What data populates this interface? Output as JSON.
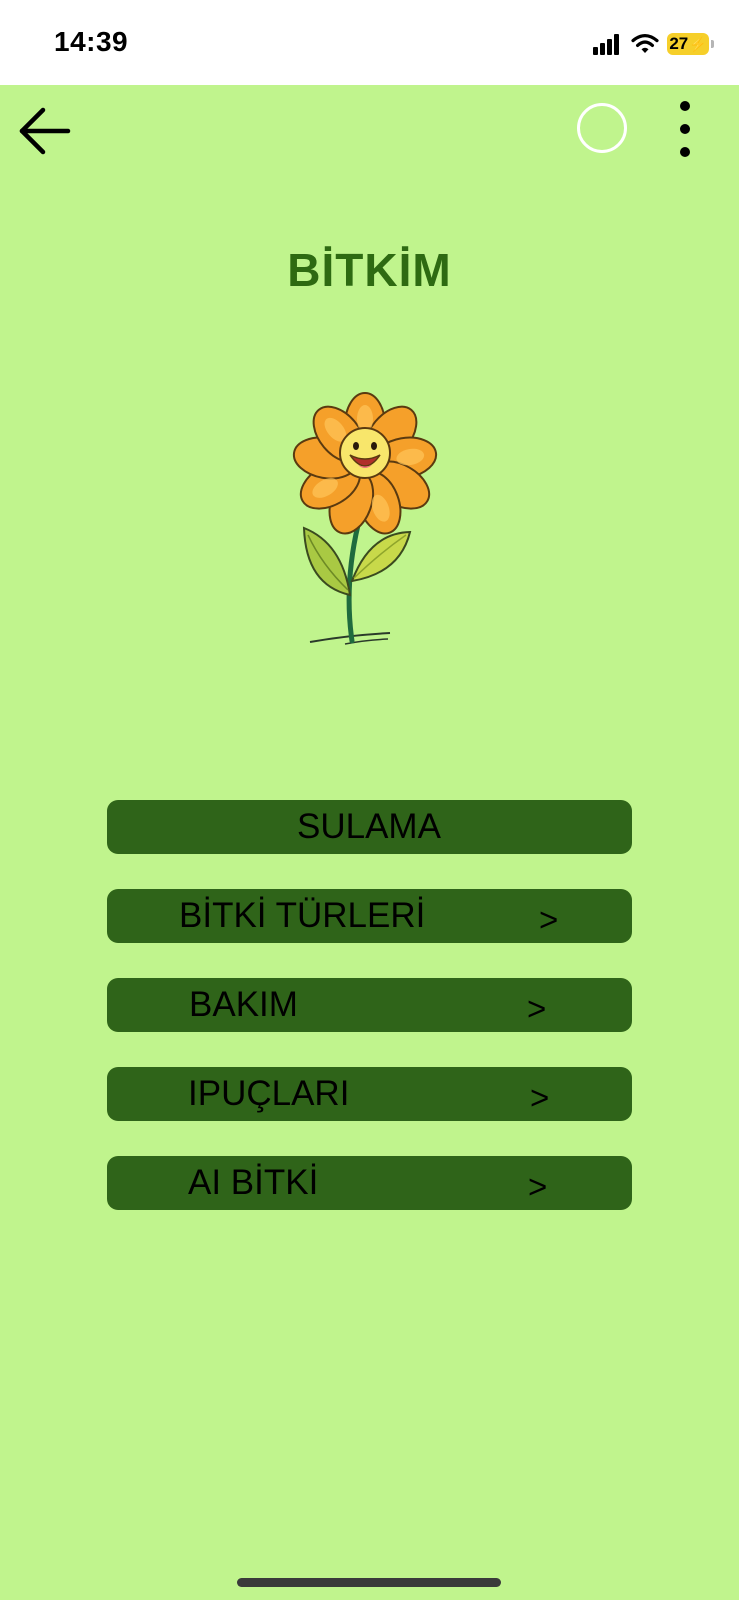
{
  "status_bar": {
    "time": "14:39",
    "battery": "27",
    "icons": [
      "signal-icon",
      "wifi-icon",
      "battery-charging-icon"
    ]
  },
  "toolbar": {
    "icons": [
      "arrow-left-icon",
      "circle-icon",
      "more-vertical-icon"
    ]
  },
  "page": {
    "title": "BİTKİM",
    "image": "flower-illustration"
  },
  "menu": {
    "items": [
      {
        "label": "SULAMA",
        "arrow": ""
      },
      {
        "label": "BİTKİ TÜRLERİ",
        "arrow": ">"
      },
      {
        "label": "BAKIM",
        "arrow": ">"
      },
      {
        "label": "IPUÇLARI",
        "arrow": ">"
      },
      {
        "label": "AI BİTKİ",
        "arrow": ">"
      }
    ]
  },
  "colors": {
    "background": "#c0f48d",
    "title": "#2e6a12",
    "button": "#2f6419",
    "battery": "#f6cf2a"
  }
}
